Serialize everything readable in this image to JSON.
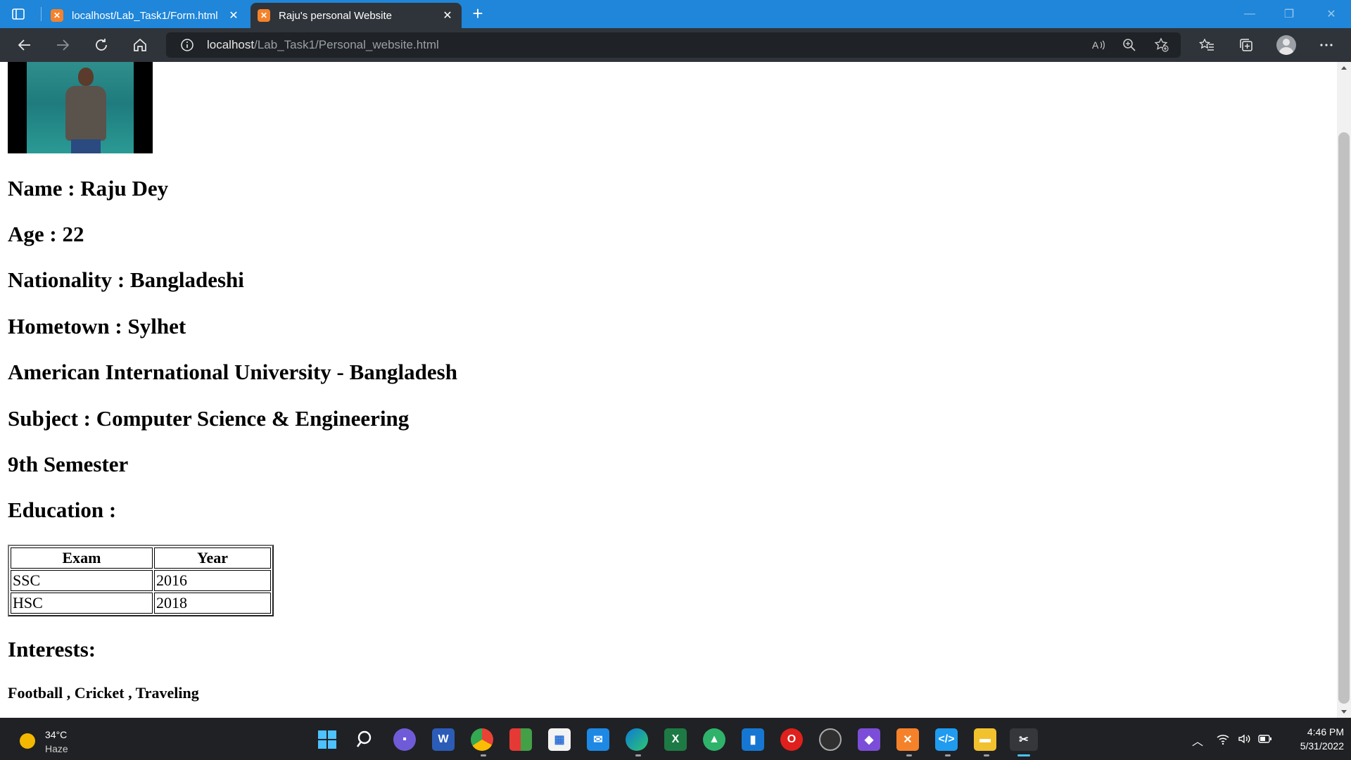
{
  "browser": {
    "tabs": [
      {
        "title": "localhost/Lab_Task1/Form.html",
        "favicon": "xampp-icon",
        "active": false
      },
      {
        "title": "Raju's personal Website",
        "favicon": "xampp-icon",
        "active": true
      }
    ],
    "address": {
      "host": "localhost",
      "path": "/Lab_Task1/Personal_website.html"
    },
    "colors": {
      "tabstrip": "#1f86d9",
      "toolbar": "#2f343a",
      "omnibox": "#1f2226"
    }
  },
  "page": {
    "photo_alt": "profile-photo",
    "name_line": "Name : Raju Dey",
    "age_line": "Age : 22",
    "nationality_line": "Nationality : Bangladeshi",
    "hometown_line": "Hometown : Sylhet",
    "university_line": "American International University - Bangladesh",
    "subject_line": "Subject : Computer Science & Engineering",
    "semester_line": "9th Semester",
    "education_heading": "Education :",
    "education_table": {
      "headers": [
        "Exam",
        "Year"
      ],
      "rows": [
        [
          "SSC",
          "2016"
        ],
        [
          "HSC",
          "2018"
        ]
      ]
    },
    "interests_heading": "Interests:",
    "interests_text": "Football , Cricket , Traveling"
  },
  "taskbar": {
    "weather": {
      "temp": "34°C",
      "condition": "Haze"
    },
    "clock": {
      "time": "4:46 PM",
      "date": "5/31/2022"
    }
  }
}
